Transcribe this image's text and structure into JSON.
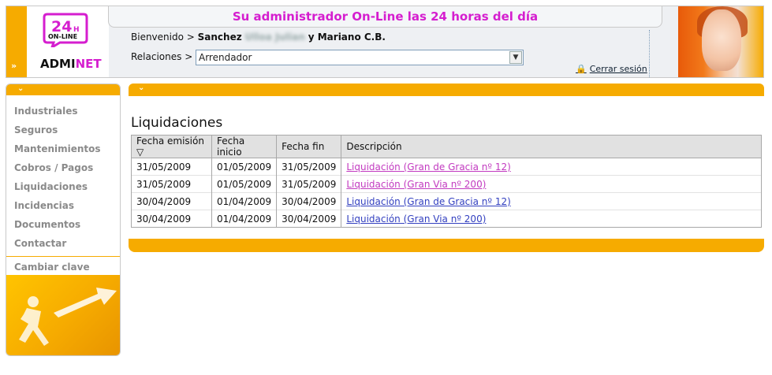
{
  "header": {
    "title": "Su administrador On-Line las 24 horas del día",
    "logo": {
      "badge_top": "24",
      "badge_h": "H",
      "badge_bottom": "ON-LINE",
      "brand_a": "ADMI",
      "brand_b": "NET"
    },
    "welcome_label": "Bienvenido >",
    "welcome_user": "Sanchez",
    "welcome_blurred": "Ulloa Julian",
    "welcome_rest": "y Mariano C.B.",
    "relations_label": "Relaciones >",
    "relations_value": "Arrendador",
    "logout_label": "Cerrar sesión"
  },
  "sidebar": {
    "items": [
      {
        "label": "Industriales"
      },
      {
        "label": "Seguros"
      },
      {
        "label": "Mantenimientos"
      },
      {
        "label": "Cobros / Pagos"
      },
      {
        "label": "Liquidaciones"
      },
      {
        "label": "Incidencias"
      },
      {
        "label": "Documentos"
      },
      {
        "label": "Contactar"
      }
    ],
    "change_password": "Cambiar clave"
  },
  "main": {
    "title": "Liquidaciones",
    "columns": [
      "Fecha emisión",
      "Fecha inicio",
      "Fecha fin",
      "Descripción"
    ],
    "sort_indicator": "▽",
    "rows": [
      {
        "emision": "31/05/2009",
        "inicio": "01/05/2009",
        "fin": "31/05/2009",
        "desc": "Liquidación (Gran de Gracia nº 12)"
      },
      {
        "emision": "31/05/2009",
        "inicio": "01/05/2009",
        "fin": "31/05/2009",
        "desc": "Liquidación (Gran Via nº 200)"
      },
      {
        "emision": "30/04/2009",
        "inicio": "01/04/2009",
        "fin": "30/04/2009",
        "desc": "Liquidación (Gran de Gracia nº 12)"
      },
      {
        "emision": "30/04/2009",
        "inicio": "01/04/2009",
        "fin": "30/04/2009",
        "desc": "Liquidación (Gran Via nº 200)"
      }
    ]
  },
  "colors": {
    "accent": "#f6ab00",
    "brand": "#d51ecf",
    "link": "#3340c0",
    "link_visited": "#c23ac0"
  }
}
